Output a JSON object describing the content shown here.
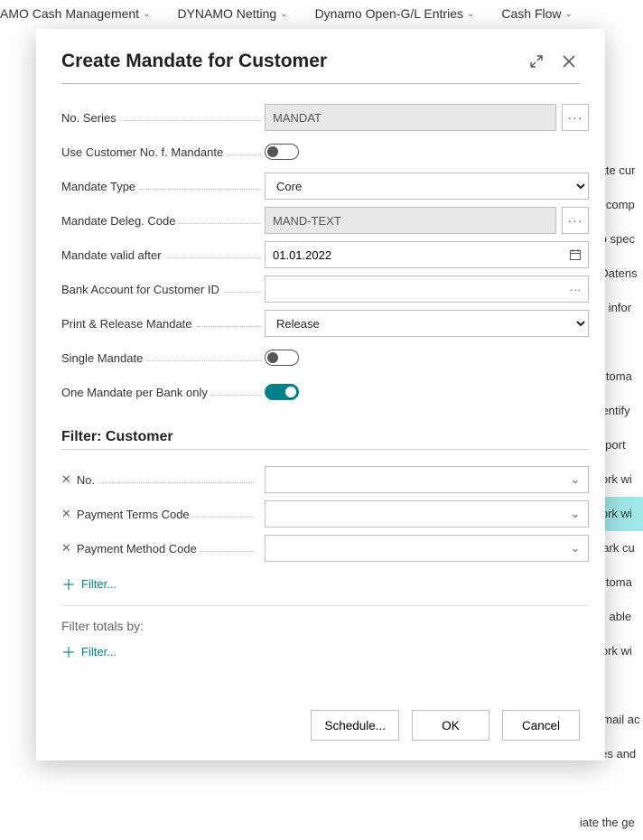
{
  "nav": {
    "items": [
      "AMO Cash Management",
      "DYNAMO Netting",
      "Dynamo Open-G/L Entries",
      "Cash Flow"
    ]
  },
  "bgLines": [
    "update cur",
    "your comp",
    "AT to spec",
    "Sie Datens",
    "atest infor",
    "",
    "to automa",
    "to identify",
    "to import",
    "to work wi",
    "to work wi",
    "to mark cu",
    "to automa",
    "to be able",
    "to work wi",
    "",
    "ne email ac",
    "voices and",
    "",
    "iate the ge"
  ],
  "modal": {
    "title": "Create Mandate for Customer",
    "fields": {
      "noSeries": {
        "label": "No. Series",
        "value": "MANDAT"
      },
      "useCustNo": {
        "label": "Use Customer No. f. Mandante",
        "on": false
      },
      "mandateType": {
        "label": "Mandate Type",
        "value": "Core"
      },
      "delegCode": {
        "label": "Mandate Deleg. Code",
        "value": "MAND-TEXT"
      },
      "validAfter": {
        "label": "Mandate valid after",
        "value": "01.01.2022"
      },
      "bankAcct": {
        "label": "Bank Account for Customer ID",
        "value": ""
      },
      "printRelease": {
        "label": "Print & Release Mandate",
        "value": "Release"
      },
      "single": {
        "label": "Single Mandate",
        "on": false
      },
      "onePerBank": {
        "label": "One Mandate per Bank only",
        "on": true
      }
    },
    "filterSection": {
      "title": "Filter: Customer",
      "filters": [
        {
          "label": "No."
        },
        {
          "label": "Payment Terms Code"
        },
        {
          "label": "Payment Method Code"
        }
      ],
      "addFilter": "Filter...",
      "totalsLabel": "Filter totals by:"
    },
    "footer": {
      "schedule": "Schedule...",
      "ok": "OK",
      "cancel": "Cancel"
    }
  }
}
